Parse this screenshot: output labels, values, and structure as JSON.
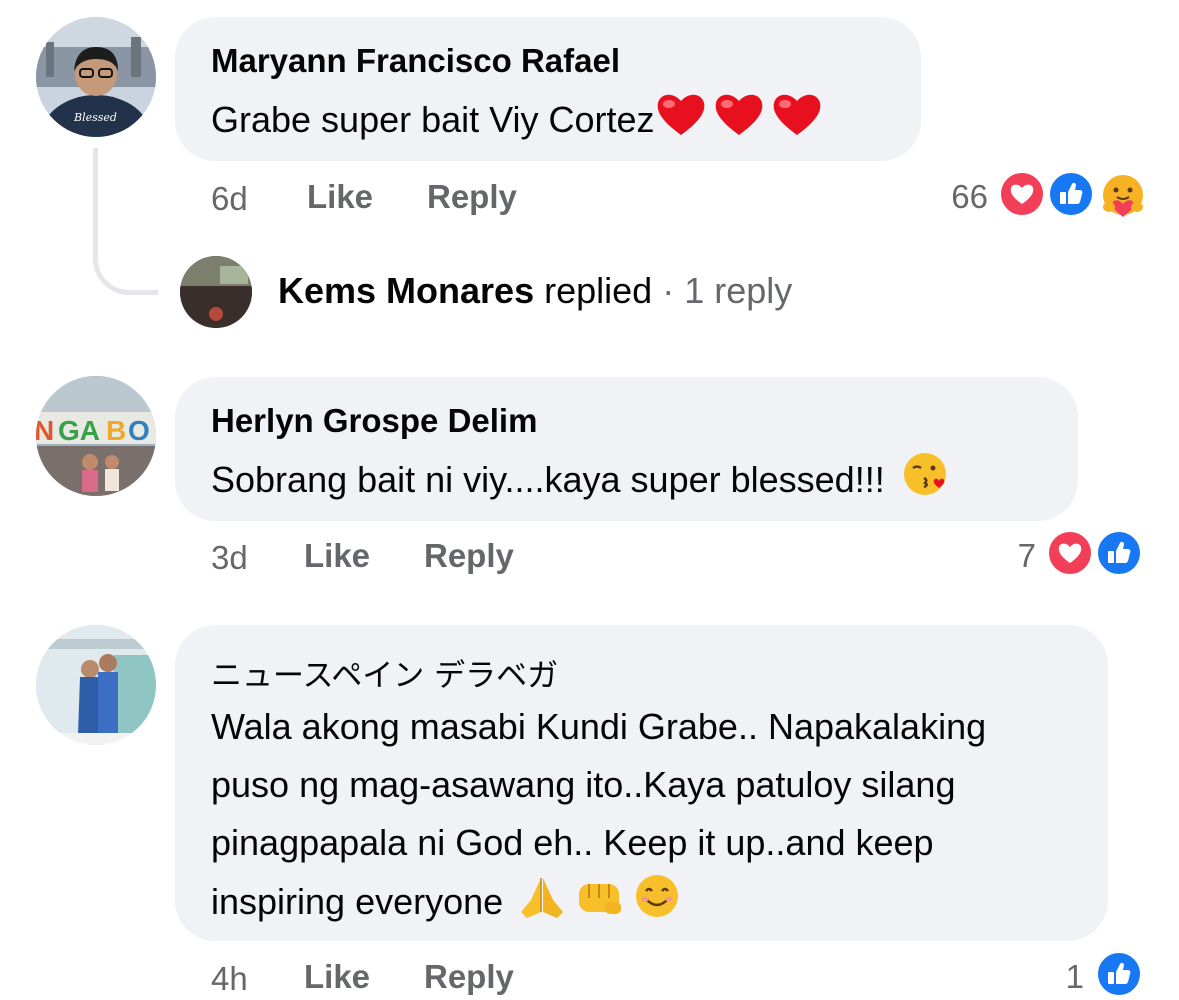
{
  "comments": [
    {
      "author": "Maryann Francisco Rafael",
      "text": "Grabe super bait Viy Cortez",
      "time": "6d",
      "like_label": "Like",
      "reply_label": "Reply",
      "reaction_count": "66",
      "reactions": [
        "heart-icon",
        "thumbs-up-icon",
        "care-icon"
      ],
      "emojis": [
        "red-heart",
        "red-heart",
        "red-heart"
      ]
    },
    {
      "author": "Herlyn Grospe Delim",
      "text": "Sobrang bait ni viy....kaya super blessed!!!",
      "time": "3d",
      "like_label": "Like",
      "reply_label": "Reply",
      "reaction_count": "7",
      "reactions": [
        "heart-icon",
        "thumbs-up-icon"
      ],
      "emojis": [
        "face-blowing-kiss"
      ]
    },
    {
      "author": "ニュースペイン デラベガ",
      "text_lines": [
        "Wala akong masabi Kundi Grabe.. Napakalaking",
        "puso ng mag-asawang ito..Kaya patuloy silang",
        "pinagpapala ni God eh.. Keep it up..and keep",
        "inspiring everyone"
      ],
      "time": "4h",
      "like_label": "Like",
      "reply_label": "Reply",
      "reaction_count": "1",
      "reactions": [
        "thumbs-up-icon"
      ],
      "emojis": [
        "folded-hands",
        "oncoming-fist",
        "smiling-face"
      ]
    }
  ],
  "reply_summary": {
    "author": "Kems Monares",
    "verb": "replied",
    "separator": "·",
    "count_label": "1 reply"
  },
  "colors": {
    "bubble": "#f0f2f5",
    "secondary_text": "#65676b",
    "heart": "#f33e58",
    "like": "#1877f2"
  }
}
